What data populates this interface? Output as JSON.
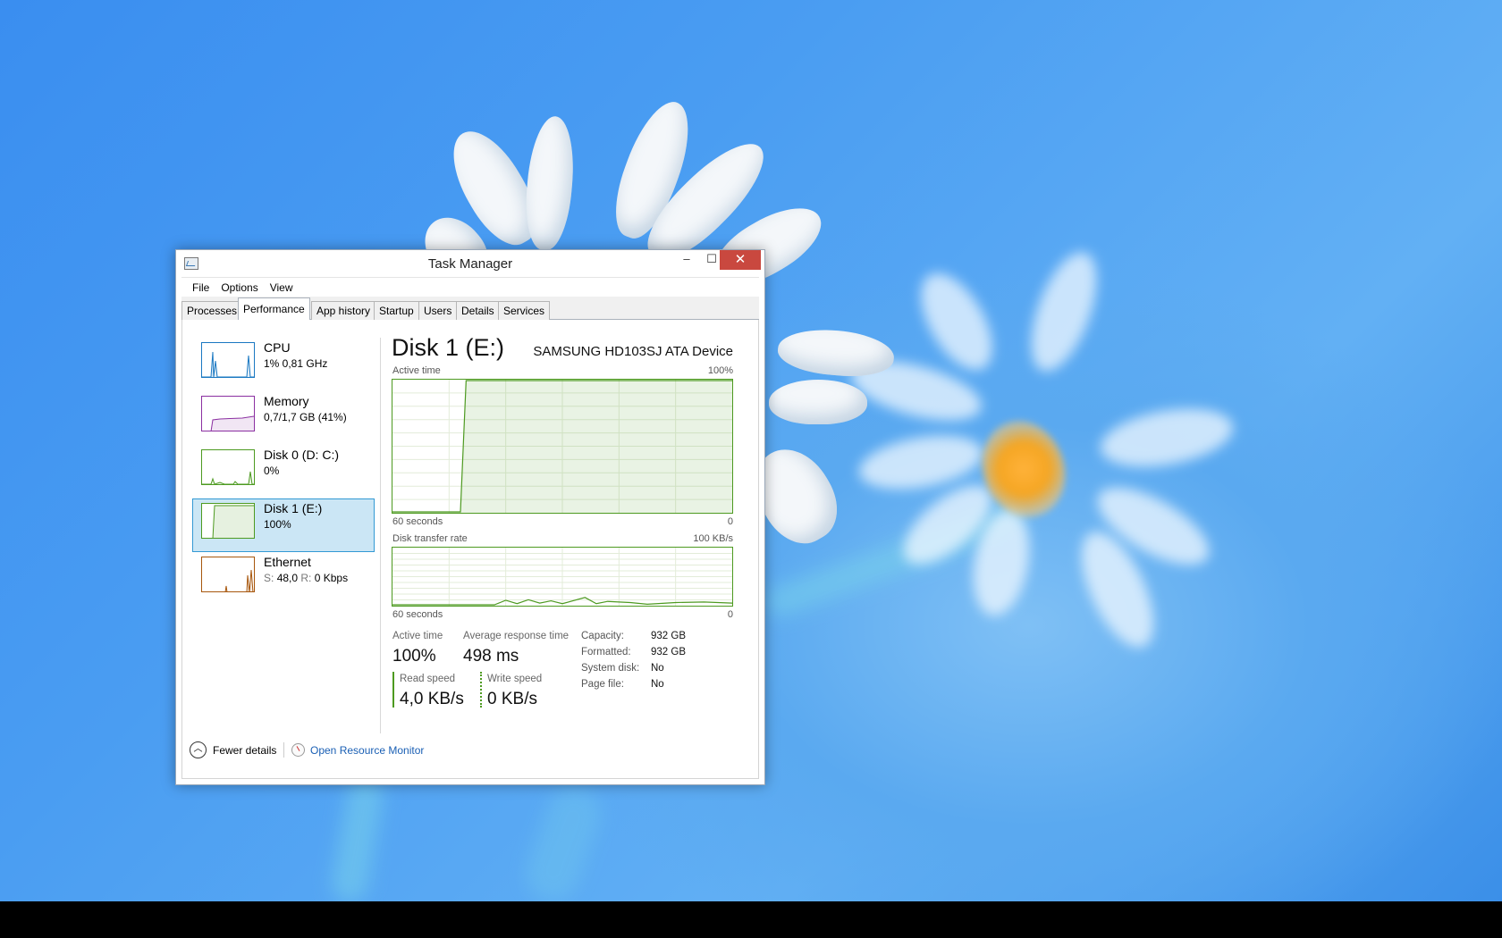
{
  "window": {
    "title": "Task Manager",
    "caption": {
      "minimize": "–",
      "maximize": "☐",
      "close": "✕"
    }
  },
  "menu": [
    "File",
    "Options",
    "View"
  ],
  "tabs": [
    "Processes",
    "Performance",
    "App history",
    "Startup",
    "Users",
    "Details",
    "Services"
  ],
  "active_tab": "Performance",
  "sidebar": [
    {
      "name": "CPU",
      "detail": "1% 0,81 GHz",
      "color": "#1a78c2"
    },
    {
      "name": "Memory",
      "detail": "0,7/1,7 GB (41%)",
      "color": "#8b2fa1"
    },
    {
      "name": "Disk 0 (D: C:)",
      "detail": "0%",
      "color": "#4d9a20"
    },
    {
      "name": "Disk 1 (E:)",
      "detail": "100%",
      "color": "#4d9a20",
      "selected": true
    },
    {
      "name": "Ethernet",
      "detail_s_label": "S:",
      "detail_s": "48,0",
      "detail_r_label": "R:",
      "detail_r": "0 Kbps",
      "color": "#a7560c"
    }
  ],
  "main": {
    "title": "Disk 1 (E:)",
    "device": "SAMSUNG HD103SJ ATA Device",
    "active_graph": {
      "label": "Active time",
      "max": "100%",
      "time": "60 seconds",
      "min": "0"
    },
    "transfer_graph": {
      "label": "Disk transfer rate",
      "max": "100 KB/s",
      "time": "60 seconds",
      "min": "0"
    },
    "stats": {
      "active_time_label": "Active time",
      "active_time": "100%",
      "avg_response_label": "Average response time",
      "avg_response": "498 ms",
      "read_label": "Read speed",
      "read": "4,0 KB/s",
      "write_label": "Write speed",
      "write": "0 KB/s"
    },
    "properties": [
      {
        "key": "Capacity:",
        "value": "932 GB"
      },
      {
        "key": "Formatted:",
        "value": "932 GB"
      },
      {
        "key": "System disk:",
        "value": "No"
      },
      {
        "key": "Page file:",
        "value": "No"
      }
    ]
  },
  "footer": {
    "fewer_details": "Fewer details",
    "resource_monitor": "Open Resource Monitor"
  },
  "chart_data": [
    {
      "type": "area",
      "title": "Active time",
      "x": [
        60,
        48,
        47,
        0
      ],
      "y": [
        0,
        0,
        100,
        100
      ],
      "ylim": [
        0,
        100
      ],
      "xlabel": "60 seconds"
    },
    {
      "type": "line",
      "title": "Disk transfer rate",
      "x": [
        60,
        42,
        40,
        38,
        36,
        34,
        32,
        30,
        26,
        24,
        22,
        18,
        15,
        10,
        5,
        0
      ],
      "y": [
        0,
        0,
        8,
        2,
        9,
        3,
        7,
        2,
        13,
        2,
        6,
        4,
        1,
        4,
        5,
        3
      ],
      "ylim": [
        0,
        100
      ],
      "xlabel": "60 seconds"
    }
  ]
}
